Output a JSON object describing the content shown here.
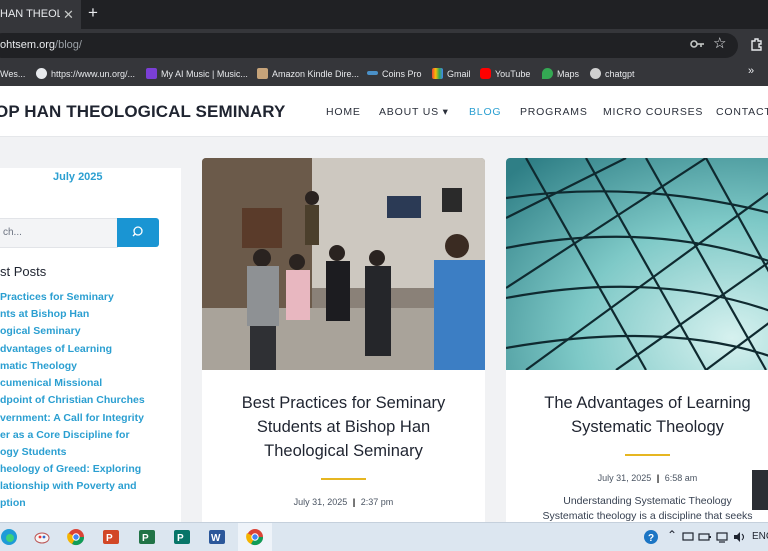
{
  "browser": {
    "tab_title": "HAN THEOLOGI",
    "new_tab_symbol": "+",
    "close_symbol": "✕",
    "url_domain": "ohtsem.org",
    "url_path": "/blog/",
    "bookmarks": [
      {
        "label": "Wes..."
      },
      {
        "label": "https://www.un.org/..."
      },
      {
        "label": "My AI Music | Music..."
      },
      {
        "label": "Amazon Kindle Dire..."
      },
      {
        "label": "Coins Pro"
      },
      {
        "label": "Gmail"
      },
      {
        "label": "YouTube"
      },
      {
        "label": "Maps"
      },
      {
        "label": "chatgpt"
      }
    ],
    "more_bookmarks": "»"
  },
  "site": {
    "title": "OP HAN THEOLOGICAL SEMINARY",
    "nav": [
      {
        "label": "HOME"
      },
      {
        "label": "ABOUT US"
      },
      {
        "label": "BLOG"
      },
      {
        "label": "PROGRAMS"
      },
      {
        "label": "MICRO COURSES"
      },
      {
        "label": "CONTACT"
      }
    ],
    "about_caret": "▾"
  },
  "sidebar": {
    "archive": "July 2025",
    "search_placeholder": "ch...",
    "recent_heading": "st Posts",
    "recent_lines": [
      "Practices for Seminary",
      "nts at Bishop Han",
      "ogical Seminary",
      "dvantages of Learning",
      "matic Theology",
      "cumenical Missional",
      "dpoint of Christian Churches",
      "vernment: A Call for Integrity",
      "er as a Core Discipline for",
      "ogy Students",
      "heology of Greed: Exploring",
      "lationship with Poverty and",
      "ption"
    ]
  },
  "cards": [
    {
      "title_lines": [
        "Best Practices for Seminary",
        "Students at Bishop Han",
        "Theological Seminary"
      ],
      "date": "July 31, 2025",
      "time": "2:37 pm"
    },
    {
      "title_lines": [
        "The Advantages of Learning",
        "Systematic Theology"
      ],
      "date": "July 31, 2025",
      "time": "6:58 am",
      "excerpt_lines": [
        "Understanding Systematic Theology",
        "Systematic theology is a discipline that seeks"
      ]
    }
  ],
  "taskbar": {
    "lang": "ENG",
    "colors": {
      "accent": "#2b9fd1",
      "gold": "#e6b621",
      "search_button": "#1a95d3"
    }
  }
}
